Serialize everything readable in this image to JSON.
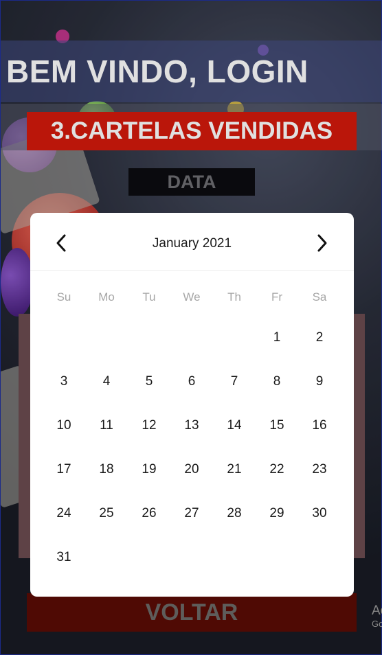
{
  "header": {
    "welcome": "BEM VINDO, LOGIN"
  },
  "section": {
    "title": "3.CARTELAS VENDIDAS"
  },
  "date_field": {
    "label": "DATA"
  },
  "footer": {
    "back_label": "VOLTAR",
    "ad_line1": "Ac",
    "ad_line2": "Go"
  },
  "calendar": {
    "month_label": "January 2021",
    "prev_icon": "chevron-left-icon",
    "next_icon": "chevron-right-icon",
    "weekdays": [
      "Su",
      "Mo",
      "Tu",
      "We",
      "Th",
      "Fr",
      "Sa"
    ],
    "leading_blanks": 5,
    "days": [
      "1",
      "2",
      "3",
      "4",
      "5",
      "6",
      "7",
      "8",
      "9",
      "10",
      "11",
      "12",
      "13",
      "14",
      "15",
      "16",
      "17",
      "18",
      "19",
      "20",
      "21",
      "22",
      "23",
      "24",
      "25",
      "26",
      "27",
      "28",
      "29",
      "30",
      "31"
    ]
  },
  "colors": {
    "title_red": "#d41a0c",
    "back_button": "#5a0c05",
    "panel": "#6b4c50"
  }
}
